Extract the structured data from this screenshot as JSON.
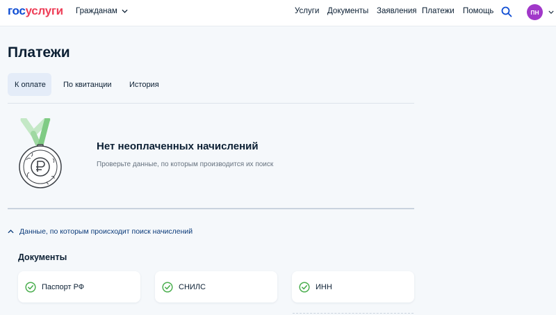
{
  "header": {
    "logo_part1": "гос",
    "logo_part2": "услуги",
    "role_label": "Гражданам",
    "nav": [
      {
        "label": "Услуги"
      },
      {
        "label": "Документы"
      },
      {
        "label": "Заявления"
      },
      {
        "label": "Платежи"
      },
      {
        "label": "Помощь"
      }
    ],
    "search_icon": "search-icon",
    "avatar_initials": "ПН"
  },
  "main": {
    "title": "Платежи",
    "tabs": [
      {
        "label": "К оплате",
        "active": true
      },
      {
        "label": "По квитанции",
        "active": false
      },
      {
        "label": "История",
        "active": false
      }
    ],
    "empty_state": {
      "icon": "ruble-medal-icon",
      "title": "Нет неоплаченных начислений",
      "subtitle": "Проверьте данные, по которым производится их поиск"
    },
    "search_data_toggle": "Данные, по которым происходит поиск начислений",
    "documents": {
      "title": "Документы",
      "items": [
        {
          "label": "Паспорт РФ",
          "status": "verified"
        },
        {
          "label": "СНИЛС",
          "status": "verified"
        },
        {
          "label": "ИНН",
          "status": "verified"
        }
      ]
    }
  },
  "colors": {
    "brand_blue": "#0d4cd3",
    "brand_red": "#ee3f58",
    "avatar": "#a138c9",
    "check_green": "#4caf50",
    "active_tab_bg": "#e4ecf8"
  }
}
